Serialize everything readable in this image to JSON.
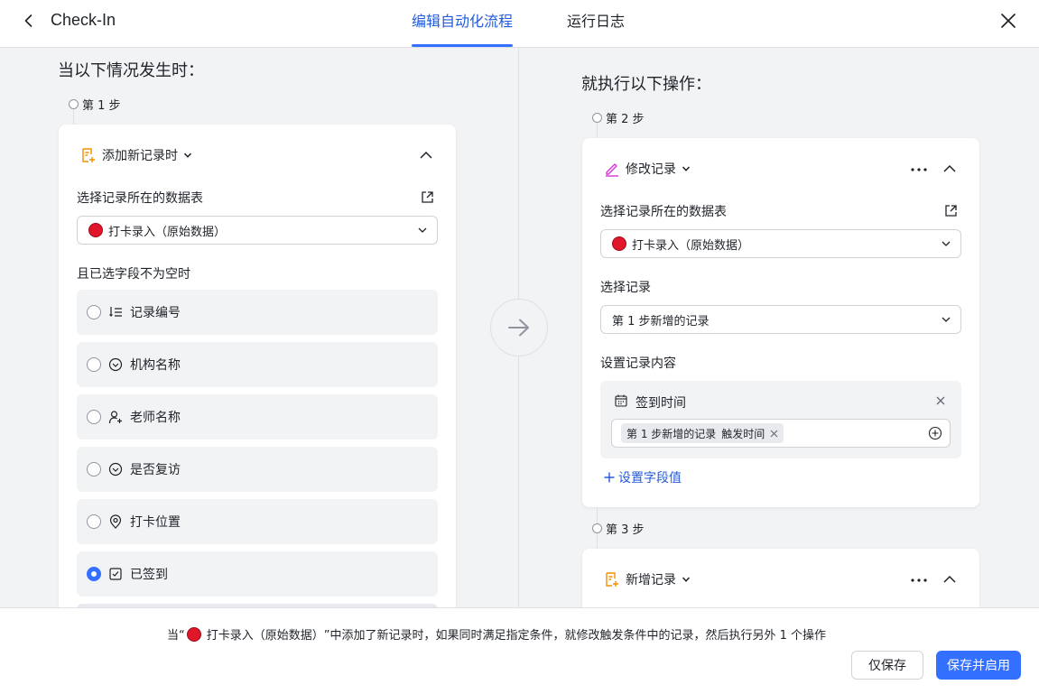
{
  "header": {
    "title": "Check-In",
    "tabs": [
      {
        "label": "编辑自动化流程",
        "active": true
      },
      {
        "label": "运行日志",
        "active": false
      }
    ]
  },
  "left": {
    "section_title": "当以下情况发生时：",
    "step_label": "第 1 步",
    "trigger": {
      "title": "添加新记录时",
      "table_label": "选择记录所在的数据表",
      "table_value": "打卡录入（原始数据）",
      "condition_label": "且已选字段不为空时",
      "fields": [
        {
          "label": "记录编号",
          "icon": "auto-number-icon",
          "checked": false
        },
        {
          "label": "机构名称",
          "icon": "single-select-icon",
          "checked": false
        },
        {
          "label": "老师名称",
          "icon": "person-icon",
          "checked": false
        },
        {
          "label": "是否复访",
          "icon": "single-select-icon",
          "checked": false
        },
        {
          "label": "打卡位置",
          "icon": "location-icon",
          "checked": false
        },
        {
          "label": "已签到",
          "icon": "checkbox-icon",
          "checked": true
        }
      ]
    }
  },
  "right": {
    "section_title": "就执行以下操作：",
    "step2_label": "第 2 步",
    "action": {
      "title": "修改记录",
      "table_label": "选择记录所在的数据表",
      "table_value": "打卡录入（原始数据）",
      "record_label": "选择记录",
      "record_value": "第 1 步新增的记录",
      "content_label": "设置记录内容",
      "field_name": "签到时间",
      "tag_source": "第 1 步新增的记录",
      "tag_field": "触发时间",
      "set_field_link": "设置字段值"
    },
    "step3_label": "第 3 步",
    "action3": {
      "title": "新增记录"
    }
  },
  "footer": {
    "summary_prefix": "当“",
    "summary_table": "打卡录入（原始数据）",
    "summary_suffix": "”中添加了新记录时，如果同时满足指定条件，就修改触发条件中的记录，然后执行另外 1 个操作",
    "save_label": "仅保存",
    "save_enable_label": "保存并启用"
  },
  "colors": {
    "accent": "#3370ff",
    "table_dot": "#e0162b",
    "edit_icon": "#d136d1",
    "trigger_icon": "#f58f00"
  }
}
